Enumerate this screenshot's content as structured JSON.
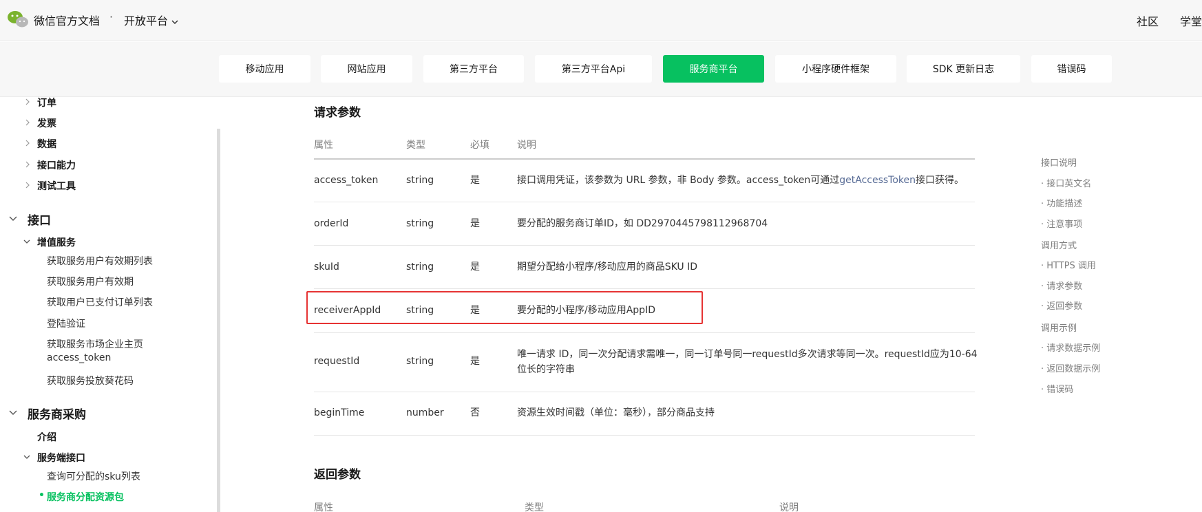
{
  "header": {
    "site_title": "微信官方文档",
    "separator": "·",
    "platform_label": "开放平台",
    "nav_right": [
      "社区",
      "学堂"
    ]
  },
  "tabs": [
    {
      "label": "移动应用",
      "active": false
    },
    {
      "label": "网站应用",
      "active": false
    },
    {
      "label": "第三方平台",
      "active": false
    },
    {
      "label": "第三方平台Api",
      "active": false
    },
    {
      "label": "服务商平台",
      "active": true
    },
    {
      "label": "小程序硬件框架",
      "active": false
    },
    {
      "label": "SDK 更新日志",
      "active": false
    },
    {
      "label": "错误码",
      "active": false
    }
  ],
  "sidebar": {
    "top_items": [
      "订单",
      "发票",
      "数据",
      "接口能力",
      "测试工具"
    ],
    "section_api": "接口",
    "group_value_added": "增值服务",
    "value_added_items": [
      "获取服务用户有效期列表",
      "获取服务用户有效期",
      "获取用户已支付订单列表",
      "登陆验证",
      "获取服务市场企业主页",
      "access_token",
      "获取服务投放葵花码"
    ],
    "section_purchase": "服务商采购",
    "intro": "介绍",
    "group_server_api": "服务端接口",
    "server_api_items": [
      "查询可分配的sku列表",
      "服务商分配资源包"
    ]
  },
  "request_params": {
    "title": "请求参数",
    "headers": [
      "属性",
      "类型",
      "必填",
      "说明"
    ],
    "rows": [
      {
        "name": "access_token",
        "type": "string",
        "required": "是",
        "desc_pre": "接口调用凭证，该参数为 URL 参数，非 Body 参数。access_token可通过",
        "desc_link": "getAccessToken",
        "desc_post": "接口获得。"
      },
      {
        "name": "orderId",
        "type": "string",
        "required": "是",
        "desc": "要分配的服务商订单ID，如 DD2970445798112968704"
      },
      {
        "name": "skuId",
        "type": "string",
        "required": "是",
        "desc": "期望分配给小程序/移动应用的商品SKU ID"
      },
      {
        "name": "receiverAppId",
        "type": "string",
        "required": "是",
        "desc": "要分配的小程序/移动应用AppID"
      },
      {
        "name": "requestId",
        "type": "string",
        "required": "是",
        "desc_line1": "唯一请求 ID，同一次分配请求需唯一，同一订单号同一requestId多次请求等同一次。requestId应为10-64",
        "desc_line2": "位长的字符串"
      },
      {
        "name": "beginTime",
        "type": "number",
        "required": "否",
        "desc": "资源生效时间戳（单位：毫秒），部分商品支持"
      }
    ]
  },
  "return_params": {
    "title": "返回参数",
    "headers": [
      "属性",
      "类型",
      "说明"
    ]
  },
  "toc": [
    "接口说明",
    "· 接口英文名",
    "· 功能描述",
    "· 注意事项",
    "调用方式",
    "· HTTPS 调用",
    "· 请求参数",
    "· 返回参数",
    "调用示例",
    "· 请求数据示例",
    "· 返回数据示例",
    "· 错误码"
  ],
  "colors": {
    "accent": "#07c160",
    "link": "#576b95",
    "highlight_border": "#e63333"
  }
}
